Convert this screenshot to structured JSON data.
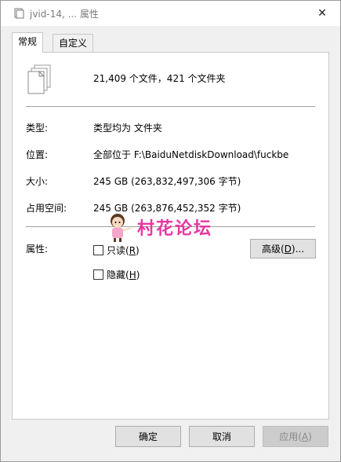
{
  "window": {
    "title": "jvid-14, ... 属性",
    "close_glyph": "✕"
  },
  "tabs": [
    {
      "label": "常规",
      "active": true
    },
    {
      "label": "自定义",
      "active": false
    }
  ],
  "general": {
    "summary": "21,409 个文件，421 个文件夹",
    "rows": [
      {
        "label": "类型:",
        "value": "类型均为 文件夹"
      },
      {
        "label": "位置:",
        "value": "全部位于 F:\\BaiduNetdiskDownload\\fuckbe"
      },
      {
        "label": "大小:",
        "value": "245 GB (263,832,497,306 字节)"
      },
      {
        "label": "占用空间:",
        "value": "245 GB (263,876,452,352 字节)"
      }
    ],
    "attributes_label": "属性:",
    "readonly": {
      "label": "只读",
      "accel": "R",
      "checked": false
    },
    "hidden": {
      "label": "隐藏",
      "accel": "H",
      "checked": false
    },
    "advanced": {
      "label": "高级",
      "accel": "D",
      "suffix": "..."
    }
  },
  "footer": {
    "ok": "确定",
    "cancel": "取消",
    "apply": {
      "label": "应用",
      "accel": "A",
      "enabled": false
    }
  },
  "watermark": {
    "text": "村花论坛",
    "color": "#e8279a"
  },
  "icons": {
    "title": "folder-properties-icon",
    "files": "multiple-files-icon",
    "close": "close-icon"
  }
}
